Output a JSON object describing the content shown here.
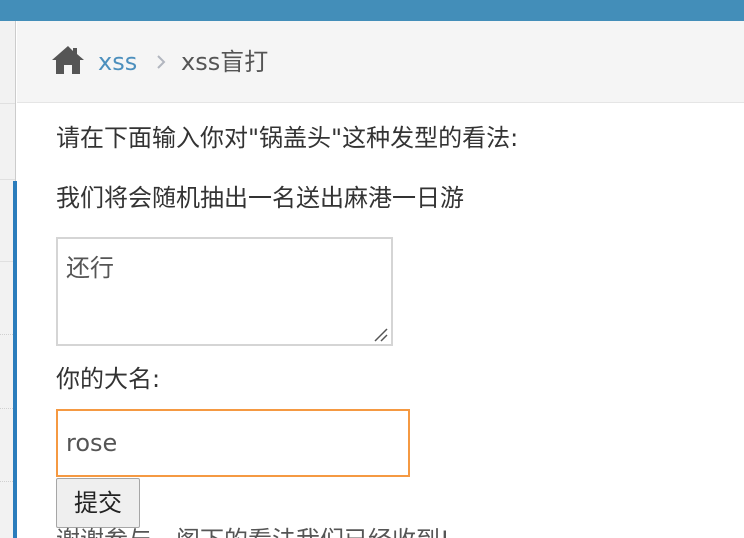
{
  "breadcrumb": {
    "home_icon": "home-icon",
    "link": "xss",
    "separator_icon": "chevron-right-icon",
    "active": "xss盲打"
  },
  "form": {
    "prompt": "请在下面输入你对\"锅盖头\"这种发型的看法:",
    "lottery_note": "我们将会随机抽出一名送出麻港一日游",
    "comment_value": "还行",
    "name_label": "你的大名:",
    "name_value": "rose",
    "submit_label": "提交",
    "footer_text": "谢谢参与，阁下的看法我们已经收到!"
  },
  "colors": {
    "topbar": "#438eb9",
    "link": "#4c8fbd",
    "active_sidebar": "#2b7dbc",
    "input_focus_border": "#f59942"
  }
}
